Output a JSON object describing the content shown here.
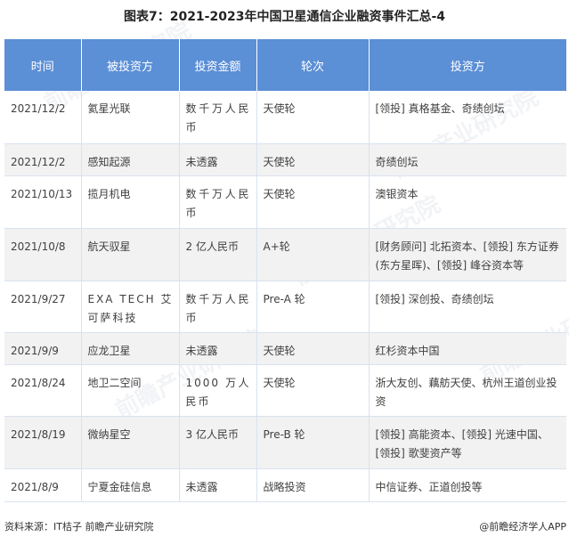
{
  "title": "图表7：2021-2023年中国卫星通信企业融资事件汇总-4",
  "table": {
    "headers": [
      "时间",
      "被投资方",
      "投资金额",
      "轮次",
      "投资方"
    ],
    "rows": [
      [
        "2021/12/2",
        "氦星光联",
        "数千万人民币",
        "天使轮",
        "[领投] 真格基金、奇绩创坛"
      ],
      [
        "2021/12/2",
        "感知起源",
        "未透露",
        "天使轮",
        "奇绩创坛"
      ],
      [
        "2021/10/13",
        "揽月机电",
        "数千万人民币",
        "天使轮",
        "澳银资本"
      ],
      [
        "2021/10/8",
        "航天驭星",
        "2 亿人民币",
        "A+轮",
        "[财务顾问] 北拓资本、[领投] 东方证券(东方星晖)、[领投] 峰谷资本等"
      ],
      [
        "2021/9/27",
        "EXA TECH 艾可萨科技",
        "数千万人民币",
        "Pre-A 轮",
        "[领投] 深创投、奇绩创坛"
      ],
      [
        "2021/9/9",
        "应龙卫星",
        "未透露",
        "天使轮",
        "红杉资本中国"
      ],
      [
        "2021/8/24",
        "地卫二空间",
        "1000 万人民币",
        "天使轮",
        "浙大友创、藕舫天使、杭州王道创业投资"
      ],
      [
        "2021/8/19",
        "微纳星空",
        "3 亿人民币",
        "Pre-B 轮",
        "[领投] 高能资本、[领投] 光速中国、[领投] 歌斐资产等"
      ],
      [
        "2021/8/9",
        "宁夏金硅信息",
        "未透露",
        "战略投资",
        "中信证券、正道创投等"
      ]
    ]
  },
  "footer": {
    "source": "资料来源：IT桔子 前瞻产业研究院",
    "brand": "@前瞻经济学人APP"
  },
  "watermark": "前瞻产业研究院"
}
